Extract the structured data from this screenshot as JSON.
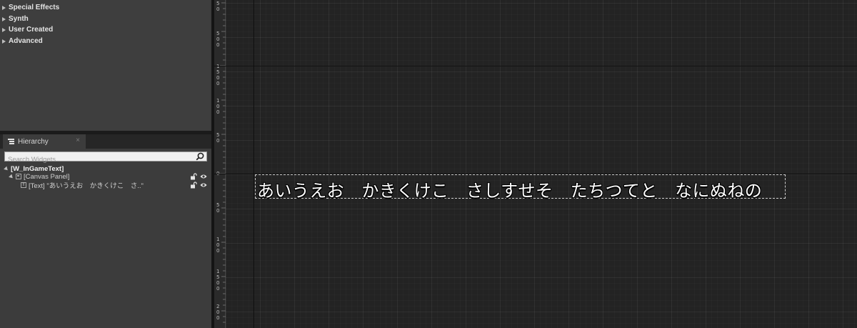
{
  "palette": {
    "categories": [
      {
        "label": "Special Effects"
      },
      {
        "label": "Synth"
      },
      {
        "label": "User Created"
      },
      {
        "label": "Advanced"
      }
    ]
  },
  "hierarchy": {
    "tab_label": "Hierarchy",
    "close_glyph": "×",
    "search_placeholder": "Search Widgets",
    "tree": {
      "root": "[W_InGameText]",
      "canvas": "[Canvas Panel]",
      "text_item": "[Text] \"あいうえお　かきくけこ　さ..\""
    },
    "icons": [
      "hierarchy-icon",
      "search-icon",
      "lock-icon",
      "eye-icon"
    ]
  },
  "designer": {
    "text_widget_content": "あいうえお　かきくけこ　さしすせそ　たちつてと　なにぬねの"
  },
  "colors": {
    "panel_bg": "#3c3c3c",
    "canvas_bg": "#232323",
    "text_color": "#ffffff"
  }
}
